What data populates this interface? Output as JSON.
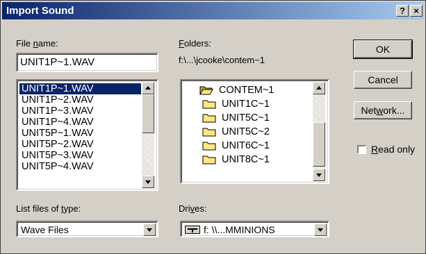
{
  "title": "Import Sound",
  "title_buttons": {
    "help": "?",
    "close": "×"
  },
  "file_name": {
    "label_pre": "File ",
    "label_accel": "n",
    "label_post": "ame:",
    "value": "UNIT1P~1.WAV"
  },
  "files": [
    {
      "name": "UNIT1P~1.WAV",
      "selected": true
    },
    {
      "name": "UNIT1P~2.WAV",
      "selected": false
    },
    {
      "name": "UNIT1P~3.WAV",
      "selected": false
    },
    {
      "name": "UNIT1P~4.WAV",
      "selected": false
    },
    {
      "name": "UNIT5P~1.WAV",
      "selected": false
    },
    {
      "name": "UNIT5P~2.WAV",
      "selected": false
    },
    {
      "name": "UNIT5P~3.WAV",
      "selected": false
    },
    {
      "name": "UNIT5P~4.WAV",
      "selected": false
    }
  ],
  "folders": {
    "label_accel": "F",
    "label_post": "olders:",
    "path": "f:\\...\\jcooke\\contem~1",
    "items": [
      {
        "name": "CONTEM~1",
        "icon": "open-folder-icon"
      },
      {
        "name": "UNIT1C~1",
        "icon": "folder-icon"
      },
      {
        "name": "UNIT5C~1",
        "icon": "folder-icon"
      },
      {
        "name": "UNIT5C~2",
        "icon": "folder-icon"
      },
      {
        "name": "UNIT6C~1",
        "icon": "folder-icon"
      },
      {
        "name": "UNIT8C~1",
        "icon": "folder-icon"
      }
    ]
  },
  "buttons": {
    "ok": "OK",
    "cancel": "Cancel",
    "network_pre": "Net",
    "network_accel": "w",
    "network_post": "ork..."
  },
  "read_only": {
    "accel": "R",
    "post": "ead only",
    "checked": false
  },
  "file_type": {
    "label_pre": "List files of ",
    "label_accel": "t",
    "label_post": "ype:",
    "value": "Wave Files"
  },
  "drives": {
    "label_pre": "Dri",
    "label_accel": "v",
    "label_post": "es:",
    "value": "f: \\\\...MMINIONS",
    "icon": "network-drive-icon"
  },
  "colors": {
    "titlebar_start": "#0a246a",
    "titlebar_end": "#a6caf0",
    "face": "#d4d0c8",
    "selection": "#0a246a"
  }
}
